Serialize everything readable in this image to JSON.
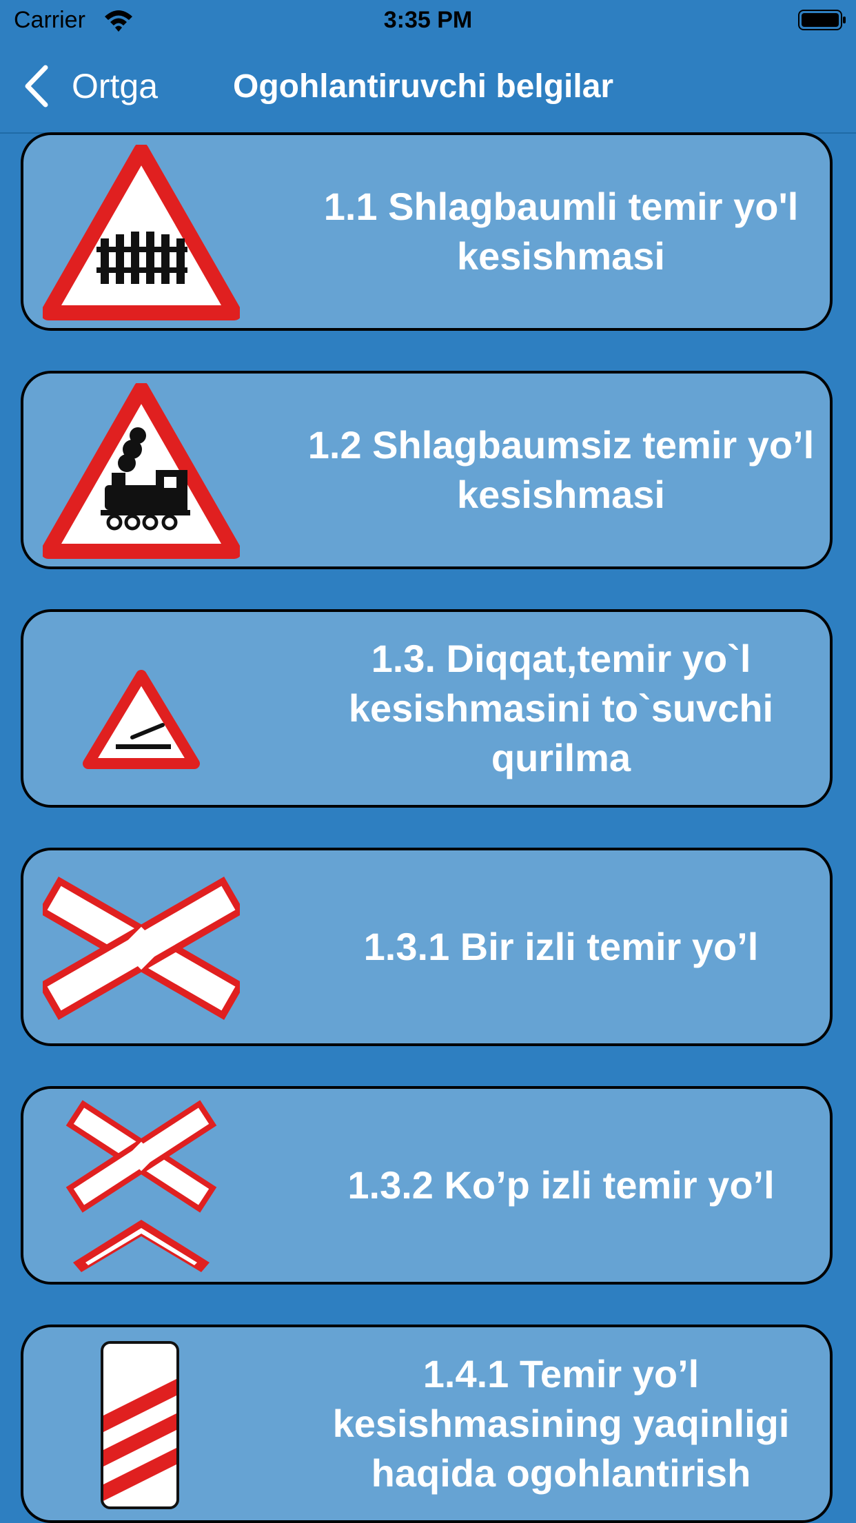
{
  "status_bar": {
    "carrier": "Carrier",
    "time": "3:35 PM"
  },
  "nav": {
    "back_label": "Ortga",
    "title": "Ogohlantiruvchi belgilar"
  },
  "items": [
    {
      "label": "1.1 Shlagbaumli temir yo'l kesishmasi",
      "icon": "railway-crossing-with-barrier-sign"
    },
    {
      "label": "1.2 Shlagbaumsiz temir yo’l kesishmasi",
      "icon": "railway-crossing-without-barrier-sign"
    },
    {
      "label": "1.3. Diqqat,temir yo`l kesishmasini to`suvchi qurilma",
      "icon": "crossing-barrier-device-sign"
    },
    {
      "label": "1.3.1 Bir izli temir yo’l",
      "icon": "single-track-cross-sign"
    },
    {
      "label": "1.3.2 Ko’p izli temir yo’l",
      "icon": "multi-track-cross-sign"
    },
    {
      "label": "1.4.1 Temir yo’l kesishmasining yaqinligi haqida ogohlantirish",
      "icon": "approach-warning-post-sign"
    }
  ],
  "colors": {
    "background": "#2e7fc1",
    "card": "#66a3d3",
    "sign_red": "#e02020"
  }
}
